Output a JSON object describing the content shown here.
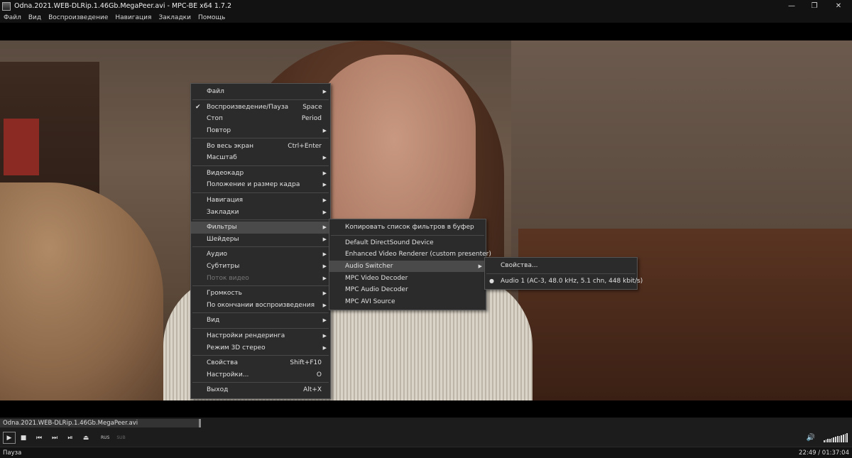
{
  "window": {
    "title": "Odna.2021.WEB-DLRip.1.46Gb.MegaPeer.avi - MPC-BE x64 1.7.2",
    "controls": [
      "minimize-icon",
      "restore-icon",
      "close-icon"
    ]
  },
  "menubar": [
    "Файл",
    "Вид",
    "Воспроизведение",
    "Навигация",
    "Закладки",
    "Помощь"
  ],
  "context_menu": {
    "groups": [
      [
        {
          "label": "Файл",
          "submenu": true
        }
      ],
      [
        {
          "label": "Воспроизведение/Пауза",
          "shortcut": "Space",
          "checked": true
        },
        {
          "label": "Стоп",
          "shortcut": "Period"
        },
        {
          "label": "Повтор",
          "submenu": true
        }
      ],
      [
        {
          "label": "Во весь экран",
          "shortcut": "Ctrl+Enter"
        },
        {
          "label": "Масштаб",
          "submenu": true
        }
      ],
      [
        {
          "label": "Видеокадр",
          "submenu": true
        },
        {
          "label": "Положение и размер кадра",
          "submenu": true
        }
      ],
      [
        {
          "label": "Навигация",
          "submenu": true
        },
        {
          "label": "Закладки",
          "submenu": true
        }
      ],
      [
        {
          "label": "Фильтры",
          "submenu": true,
          "selected": true
        },
        {
          "label": "Шейдеры",
          "submenu": true
        }
      ],
      [
        {
          "label": "Аудио",
          "submenu": true
        },
        {
          "label": "Субтитры",
          "submenu": true
        },
        {
          "label": "Поток видео",
          "submenu": true,
          "disabled": true
        }
      ],
      [
        {
          "label": "Громкость",
          "submenu": true
        },
        {
          "label": "По окончании воспроизведения",
          "submenu": true
        }
      ],
      [
        {
          "label": "Вид",
          "submenu": true
        }
      ],
      [
        {
          "label": "Настройки рендеринга",
          "submenu": true
        },
        {
          "label": "Режим 3D стерео",
          "submenu": true
        }
      ],
      [
        {
          "label": "Свойства",
          "shortcut": "Shift+F10"
        },
        {
          "label": "Настройки...",
          "shortcut": "O"
        }
      ],
      [
        {
          "label": "Выход",
          "shortcut": "Alt+X"
        }
      ]
    ]
  },
  "filters_menu": {
    "groups": [
      [
        {
          "label": "Копировать список фильтров в буфер"
        }
      ],
      [
        {
          "label": "Default DirectSound Device"
        },
        {
          "label": "Enhanced Video Renderer (custom presenter)"
        },
        {
          "label": "Audio Switcher",
          "submenu": true,
          "selected": true
        },
        {
          "label": "MPC Video Decoder"
        },
        {
          "label": "MPC Audio Decoder"
        },
        {
          "label": "MPC AVI Source"
        }
      ]
    ]
  },
  "audio_switcher_menu": {
    "groups": [
      [
        {
          "label": "Свойства..."
        }
      ],
      [
        {
          "label": "Audio 1 (AC-3, 48.0 kHz, 5.1 chn, 448 kbit/s)",
          "radio": true
        }
      ]
    ]
  },
  "seekbar": {
    "filename": "Odna.2021.WEB-DLRip.1.46Gb.MegaPeer.avi",
    "progress": 0.234
  },
  "controls": {
    "buttons": [
      "play-icon",
      "stop-icon",
      "prev-icon",
      "next-icon",
      "frame-step-icon",
      "eject-icon"
    ],
    "audio_tag": "RUS",
    "subtitle_tag": "SUB",
    "volume": 1.0
  },
  "status": {
    "state": "Пауза",
    "time": "22:49 / 01:37:04"
  },
  "colors": {
    "menu_bg": "#2b2b2b",
    "menu_selected": "#4a4a4a",
    "chrome_bg": "#121212"
  }
}
